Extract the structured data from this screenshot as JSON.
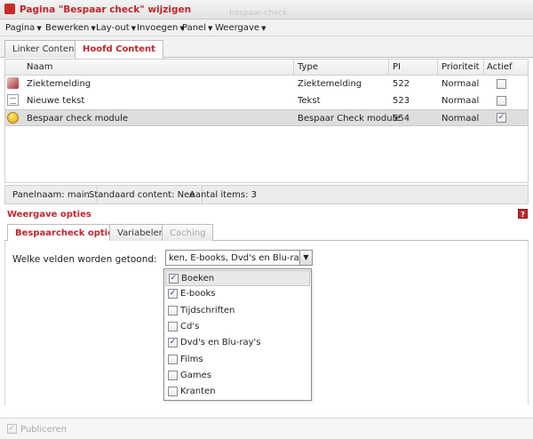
{
  "window": {
    "title": "Pagina \"Bespaar check\" wijzigen",
    "ghost_text": "bespaar-check"
  },
  "menu": [
    {
      "label": "Pagina"
    },
    {
      "label": "Bewerken"
    },
    {
      "label": "Lay-out"
    },
    {
      "label": "Invoegen"
    },
    {
      "label": "Panel"
    },
    {
      "label": "Weergave"
    }
  ],
  "top_tabs": [
    {
      "label": "Linker Content",
      "active": false
    },
    {
      "label": "Hoofd Content",
      "active": true
    }
  ],
  "grid": {
    "columns": [
      "Naam",
      "Type",
      "PI",
      "Prioriteit",
      "Actief"
    ],
    "rows": [
      {
        "icon": "sick-report-icon",
        "naam": "Ziektemelding",
        "type": "Ziektemelding",
        "pi": "522",
        "prioriteit": "Normaal",
        "actief": false,
        "selected": false
      },
      {
        "icon": "text-document-icon",
        "naam": "Nieuwe tekst",
        "type": "Tekst",
        "pi": "523",
        "prioriteit": "Normaal",
        "actief": false,
        "selected": false
      },
      {
        "icon": "coin-module-icon",
        "naam": "Bespaar check module",
        "type": "Bespaar Check module",
        "pi": "554",
        "prioriteit": "Normaal",
        "actief": true,
        "selected": true
      }
    ]
  },
  "status": {
    "panelnaam": "Panelnaam: main",
    "standaard": "Standaard content: Nee",
    "aantal": "Aantal items: 3"
  },
  "options_section": {
    "title": "Weergave opties",
    "help": "?"
  },
  "lower_tabs": [
    {
      "label": "Bespaarcheck opties",
      "state": "active"
    },
    {
      "label": "Variabelen",
      "state": "normal"
    },
    {
      "label": "Caching",
      "state": "disabled"
    }
  ],
  "field": {
    "label": "Welke velden worden getoond:",
    "value": "ken, E-books, Dvd's en Blu-ray's"
  },
  "dropdown_options": [
    {
      "label": "Boeken",
      "checked": true,
      "highlighted": true
    },
    {
      "label": "E-books",
      "checked": true,
      "highlighted": false
    },
    {
      "label": "Tijdschriften",
      "checked": false,
      "highlighted": false
    },
    {
      "label": "Cd's",
      "checked": false,
      "highlighted": false
    },
    {
      "label": "Dvd's en Blu-ray's",
      "checked": true,
      "highlighted": false
    },
    {
      "label": "Films",
      "checked": false,
      "highlighted": false
    },
    {
      "label": "Games",
      "checked": false,
      "highlighted": false
    },
    {
      "label": "Kranten",
      "checked": false,
      "highlighted": false
    }
  ],
  "footer": {
    "publish_label": "Publiceren",
    "publish_checked": true
  }
}
